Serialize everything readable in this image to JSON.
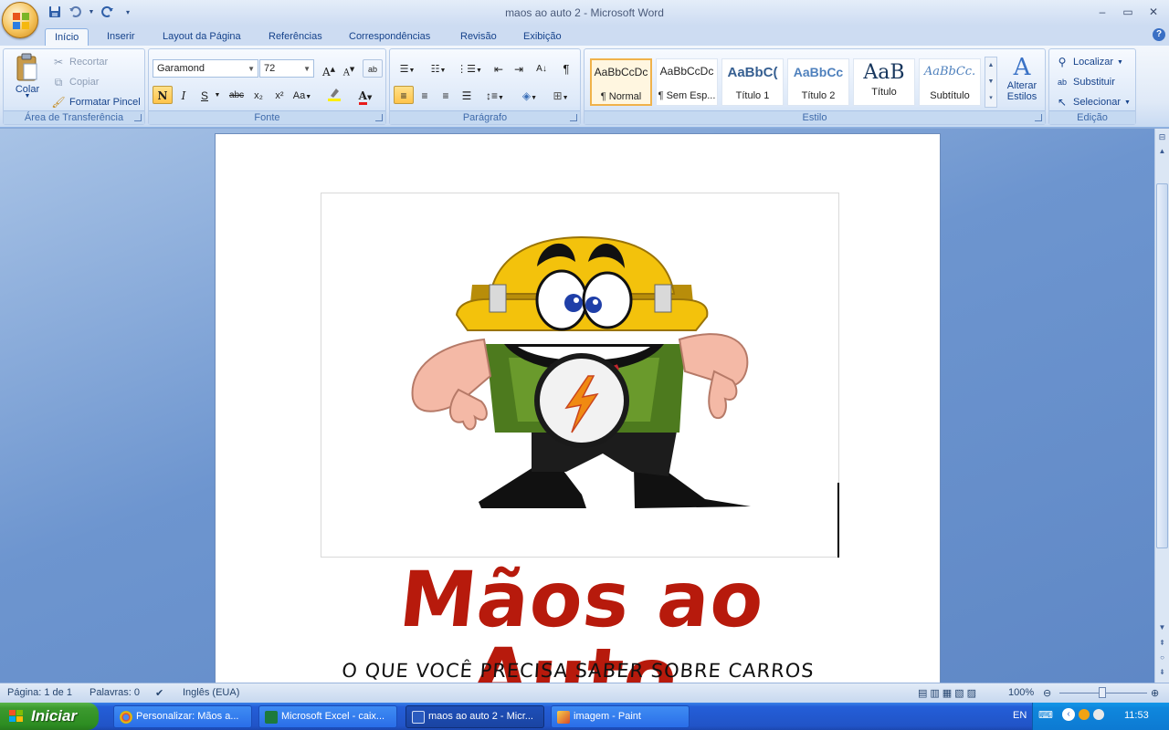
{
  "window": {
    "title": "maos ao auto 2 - Microsoft Word",
    "controls": [
      "minimize-icon",
      "restore-icon",
      "close-icon"
    ]
  },
  "qat": {
    "icons": [
      "save-icon",
      "undo-icon",
      "redo-icon",
      "customize-icon"
    ]
  },
  "tabs": [
    {
      "label": "Início",
      "active": true
    },
    {
      "label": "Inserir"
    },
    {
      "label": "Layout da Página"
    },
    {
      "label": "Referências"
    },
    {
      "label": "Correspondências"
    },
    {
      "label": "Revisão"
    },
    {
      "label": "Exibição"
    }
  ],
  "ribbon": {
    "clipboard": {
      "title": "Área de Transferência",
      "paste": "Colar",
      "cut": "Recortar",
      "copy": "Copiar",
      "format_painter": "Formatar Pincel"
    },
    "font": {
      "title": "Fonte",
      "family": "Garamond",
      "size": "72",
      "bold": "N",
      "italic": "I",
      "underline": "S",
      "strike": "abc",
      "subscript": "x₂",
      "superscript": "x²",
      "case": "Aa",
      "grow": "A",
      "shrink": "A"
    },
    "paragraph": {
      "title": "Parágrafo"
    },
    "styles": {
      "title": "Estilo",
      "items": [
        {
          "sample": "AaBbCcDc",
          "name": "¶ Normal",
          "selected": true
        },
        {
          "sample": "AaBbCcDc",
          "name": "¶ Sem Esp..."
        },
        {
          "sample": "AaBbC(",
          "name": "Título 1"
        },
        {
          "sample": "AaBbCc",
          "name": "Título 2"
        },
        {
          "sample": "AaB",
          "name": "Título"
        },
        {
          "sample": "AaBbCc.",
          "name": "Subtítulo"
        }
      ],
      "change_styles": "Alterar Estilos"
    },
    "editing": {
      "title": "Edição",
      "find": "Localizar",
      "replace": "Substituir",
      "select": "Selecionar"
    }
  },
  "document": {
    "title_art": "Mãos ao Auto",
    "subtitle_art": "O QUE VOCÊ PRECISA SABER SOBRE CARROS"
  },
  "statusbar": {
    "page": "Página: 1 de 1",
    "words": "Palavras: 0",
    "language": "Inglês (EUA)",
    "zoom": "100%"
  },
  "taskbar": {
    "start": "Iniciar",
    "tasks": [
      {
        "label": "Personalizar: Mãos a...",
        "icon": "chrome-icon"
      },
      {
        "label": "Microsoft Excel - caix...",
        "icon": "excel-icon"
      },
      {
        "label": "maos ao auto 2 - Micr...",
        "icon": "word-icon",
        "active": true
      },
      {
        "label": "imagem - Paint",
        "icon": "paint-icon"
      }
    ],
    "tray": {
      "lang": "EN",
      "time": "11:53"
    }
  }
}
